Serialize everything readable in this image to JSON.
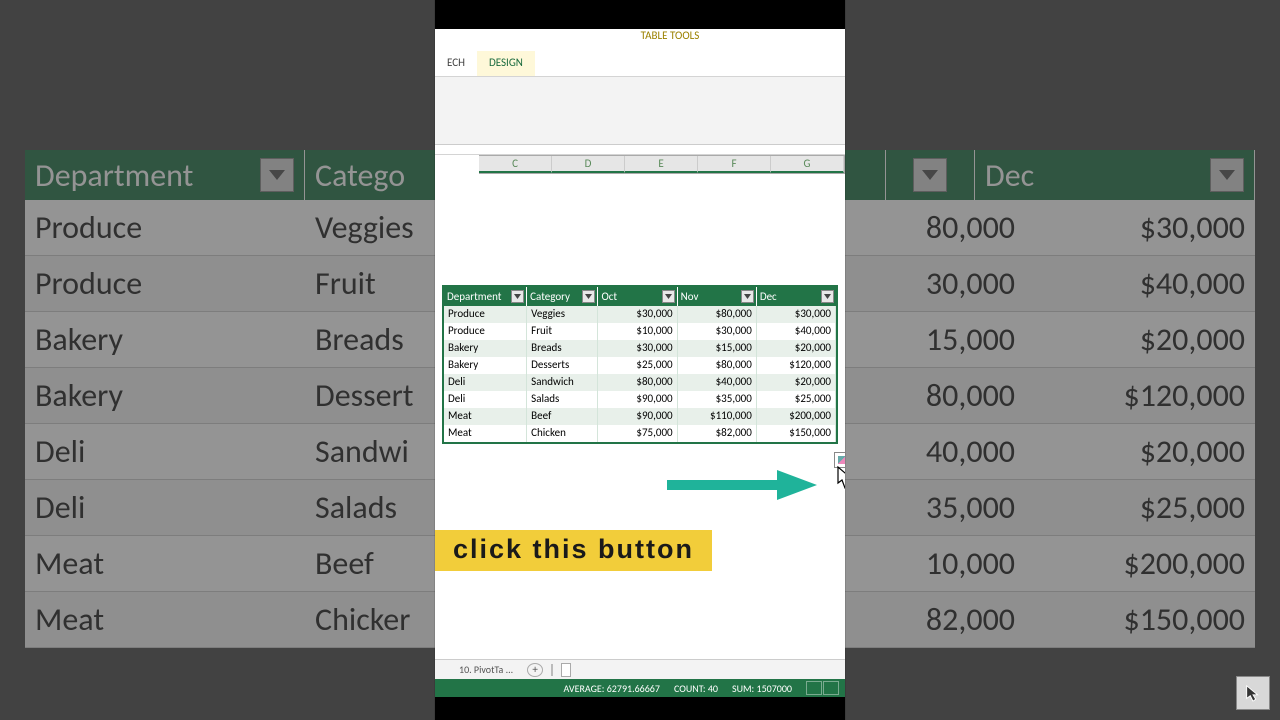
{
  "ribbon": {
    "context_title": "TABLE TOOLS",
    "tab_partial": "ECH",
    "tab_design": "DESIGN"
  },
  "col_headers": [
    "C",
    "D",
    "E",
    "F",
    "G"
  ],
  "bg": {
    "headers": {
      "dept": "Department",
      "cat": "Catego",
      "dec": "Dec"
    },
    "rows": [
      {
        "dept": "Produce",
        "cat": "Veggies",
        "nov": "80,000",
        "dec": "$30,000"
      },
      {
        "dept": "Produce",
        "cat": "Fruit",
        "nov": "30,000",
        "dec": "$40,000"
      },
      {
        "dept": "Bakery",
        "cat": "Breads",
        "nov": "15,000",
        "dec": "$20,000"
      },
      {
        "dept": "Bakery",
        "cat": "Dessert",
        "nov": "80,000",
        "dec": "$120,000"
      },
      {
        "dept": "Deli",
        "cat": "Sandwi",
        "nov": "40,000",
        "dec": "$20,000"
      },
      {
        "dept": "Deli",
        "cat": "Salads",
        "nov": "35,000",
        "dec": "$25,000"
      },
      {
        "dept": "Meat",
        "cat": "Beef",
        "nov": "10,000",
        "dec": "$200,000"
      },
      {
        "dept": "Meat",
        "cat": "Chicker",
        "nov": "82,000",
        "dec": "$150,000"
      }
    ]
  },
  "table": {
    "headers": {
      "dept": "Department",
      "cat": "Category",
      "oct": "Oct",
      "nov": "Nov",
      "dec": "Dec"
    },
    "rows": [
      {
        "dept": "Produce",
        "cat": "Veggies",
        "oct": "$30,000",
        "nov": "$80,000",
        "dec": "$30,000"
      },
      {
        "dept": "Produce",
        "cat": "Fruit",
        "oct": "$10,000",
        "nov": "$30,000",
        "dec": "$40,000"
      },
      {
        "dept": "Bakery",
        "cat": "Breads",
        "oct": "$30,000",
        "nov": "$15,000",
        "dec": "$20,000"
      },
      {
        "dept": "Bakery",
        "cat": "Desserts",
        "oct": "$25,000",
        "nov": "$80,000",
        "dec": "$120,000"
      },
      {
        "dept": "Deli",
        "cat": "Sandwich",
        "oct": "$80,000",
        "nov": "$40,000",
        "dec": "$20,000"
      },
      {
        "dept": "Deli",
        "cat": "Salads",
        "oct": "$90,000",
        "nov": "$35,000",
        "dec": "$25,000"
      },
      {
        "dept": "Meat",
        "cat": "Beef",
        "oct": "$90,000",
        "nov": "$110,000",
        "dec": "$200,000"
      },
      {
        "dept": "Meat",
        "cat": "Chicken",
        "oct": "$75,000",
        "nov": "$82,000",
        "dec": "$150,000"
      }
    ]
  },
  "callout": "click this button",
  "sheet": {
    "tab": "10. PivotTa ...",
    "add": "+"
  },
  "status": {
    "average_label": "AVERAGE:",
    "average": "62791.66667",
    "count_label": "COUNT:",
    "count": "40",
    "sum_label": "SUM:",
    "sum": "1507000"
  }
}
